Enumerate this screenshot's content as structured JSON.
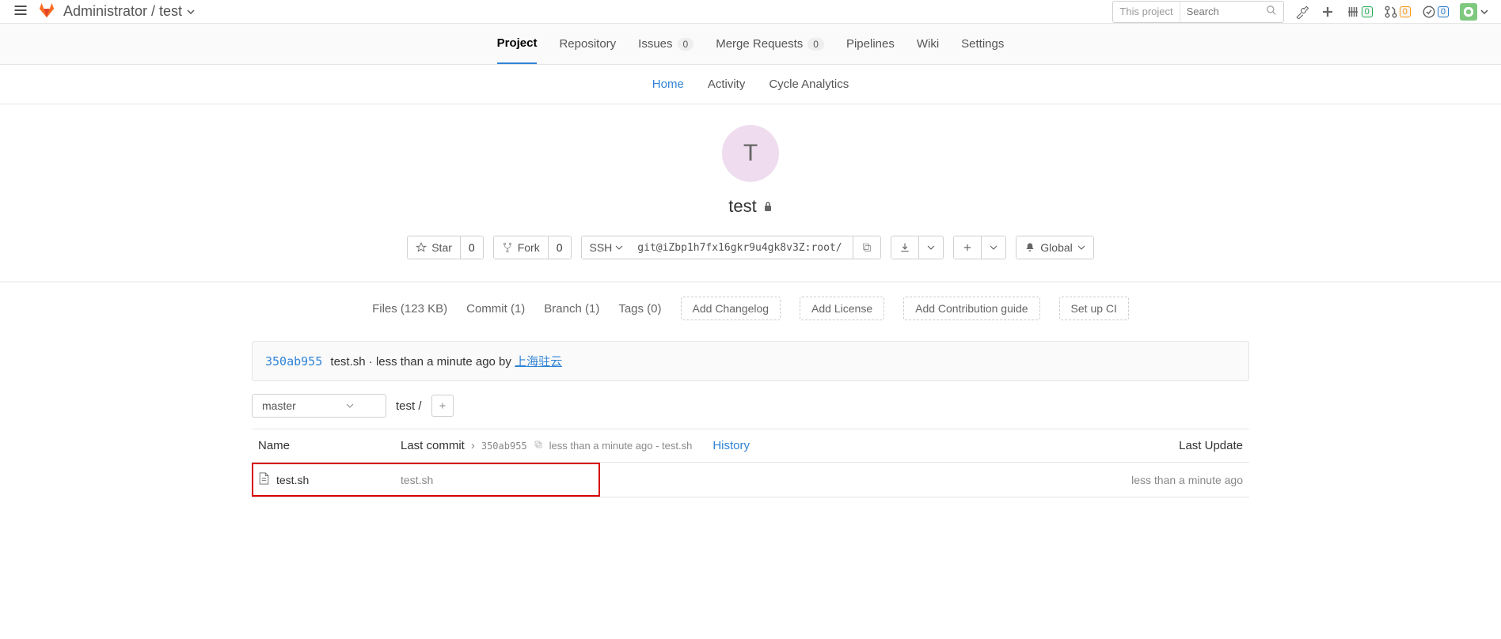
{
  "header": {
    "breadcrumb_owner": "Administrator",
    "breadcrumb_project": "test",
    "search_scope": "This project",
    "search_placeholder": "Search",
    "badge_hash": "0",
    "badge_mr": "0",
    "badge_todo": "0"
  },
  "main_nav": {
    "project": "Project",
    "repository": "Repository",
    "issues": "Issues",
    "issues_count": "0",
    "merge_requests": "Merge Requests",
    "mr_count": "0",
    "pipelines": "Pipelines",
    "wiki": "Wiki",
    "settings": "Settings"
  },
  "sub_nav": {
    "home": "Home",
    "activity": "Activity",
    "cycle": "Cycle Analytics"
  },
  "project": {
    "avatar_letter": "T",
    "name": "test",
    "star_label": "Star",
    "star_count": "0",
    "fork_label": "Fork",
    "fork_count": "0",
    "protocol": "SSH",
    "clone_url": "git@iZbp1h7fx16gkr9u4gk8v3Z:root/",
    "global_label": "Global"
  },
  "stats": {
    "files": "Files (123 KB)",
    "commit": "Commit (1)",
    "branch": "Branch (1)",
    "tags": "Tags (0)",
    "changelog": "Add Changelog",
    "license": "Add License",
    "guide": "Add Contribution guide",
    "ci": "Set up CI"
  },
  "commit_banner": {
    "sha": "350ab955",
    "message": "test.sh",
    "separator": " · ",
    "time": "less than a minute ago by ",
    "author": "上海驻云"
  },
  "branch_row": {
    "branch": "master",
    "path": "test",
    "slash": "/"
  },
  "table": {
    "col_name": "Name",
    "col_last_commit": "Last commit",
    "short_sha": "350ab955",
    "commit_meta": "less than a minute ago - test.sh",
    "history": "History",
    "col_update": "Last Update",
    "rows": [
      {
        "name": "test.sh",
        "commit_msg": "test.sh",
        "updated": "less than a minute ago"
      }
    ]
  }
}
